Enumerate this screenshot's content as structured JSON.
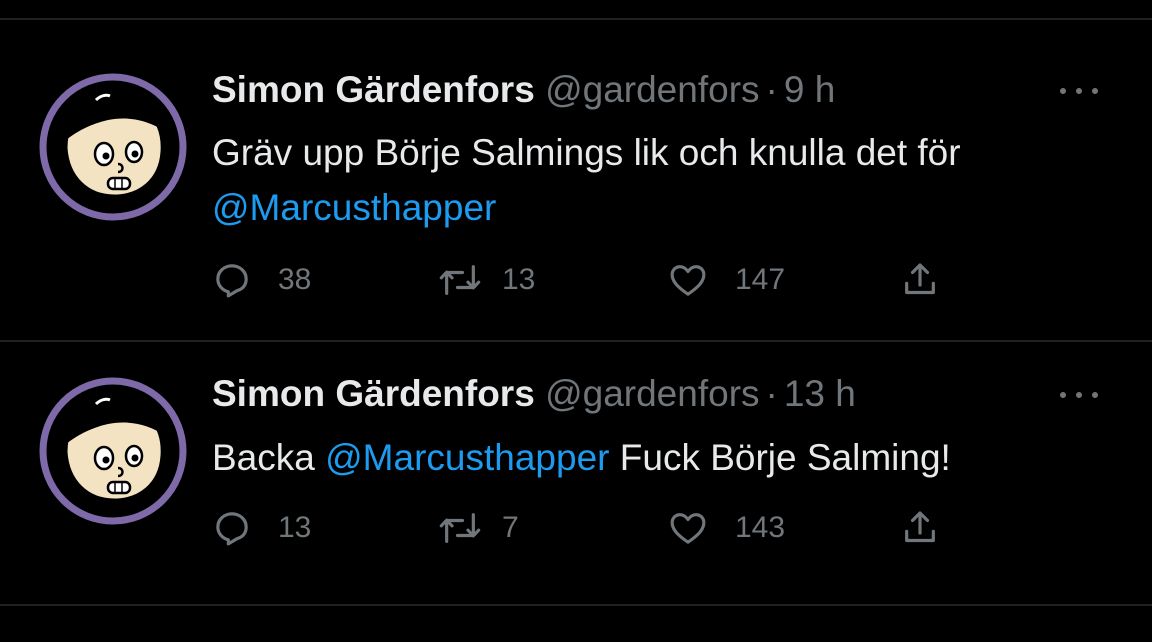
{
  "tweets": [
    {
      "name": "Simon Gärdenfors",
      "handle": "@gardenfors",
      "separator": "·",
      "time": "9 h",
      "text_parts": [
        "Gräv upp Börje Salmings lik och knulla det för",
        "@Marcusthapper"
      ],
      "replies": "38",
      "retweets": "13",
      "likes": "147",
      "icons": [
        "reply-icon",
        "retweet-icon",
        "like-icon",
        "share-icon",
        "more-icon"
      ]
    },
    {
      "name": "Simon Gärdenfors",
      "handle": "@gardenfors",
      "separator": "·",
      "time": "13 h",
      "text_parts": [
        "Backa ",
        "@Marcusthapper",
        " Fuck Börje Salming!"
      ],
      "replies": "13",
      "retweets": "7",
      "likes": "143",
      "icons": [
        "reply-icon",
        "retweet-icon",
        "like-icon",
        "share-icon",
        "more-icon"
      ]
    }
  ],
  "colors": {
    "background": "#000000",
    "text": "#e7e9ea",
    "muted": "#71767b",
    "mention": "#1d9bf0",
    "avatar_ring": "#7e6aa8",
    "avatar_skin": "#f3e3c3"
  }
}
